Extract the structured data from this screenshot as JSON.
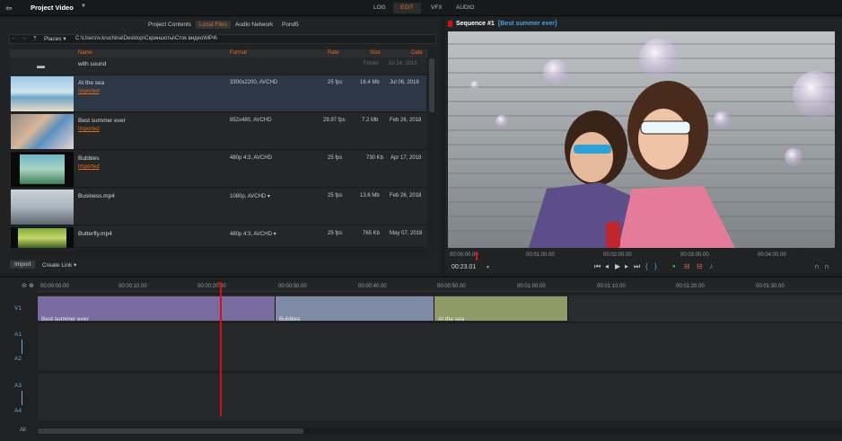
{
  "app": {
    "project_title": "Project Video",
    "modes": [
      "LOG",
      "EDIT",
      "VFX",
      "AUDIO"
    ],
    "active_mode": "EDIT"
  },
  "colors": {
    "accent": "#e46b1b",
    "playhead": "#d01414",
    "sequence_name": "#4ea0e0"
  },
  "browser": {
    "tabs": [
      "Project Contents",
      "Local Files",
      "Audio Network",
      "Pond5"
    ],
    "active_tab": "Local Files",
    "places_label": "Places",
    "path": "C:\\Users\\v.kruchina\\Desktop\\Скриншоты\\Сток видео\\MP4\\",
    "columns": [
      "Name",
      "Format",
      "Rate",
      "Size",
      "Date"
    ],
    "folder": {
      "name": "with sound",
      "size": "Folder",
      "date": "Jul 24, 2018"
    },
    "files": [
      {
        "name": "At the sea",
        "status": "Imported",
        "format": "3300x2200, AVCHD",
        "rate": "25 fps",
        "size": "16.4 Mb",
        "date": "Jul 06, 2018"
      },
      {
        "name": "Best summer ever",
        "status": "Imported",
        "format": "852x480, AVCHD",
        "rate": "29.97 fps",
        "size": "7.2 Mb",
        "date": "Feb 26, 2018"
      },
      {
        "name": "Bubbles",
        "status": "Imported",
        "format": "480p 4:3, AVCHD",
        "rate": "25 fps",
        "size": "730 Kb",
        "date": "Apr 17, 2018"
      },
      {
        "name": "Business.mp4",
        "status": "",
        "format": "1080p, AVCHD ▾",
        "rate": "25 fps",
        "size": "13.6 Mb",
        "date": "Feb 26, 2018"
      },
      {
        "name": "Butterfly.mp4",
        "status": "",
        "format": "480p 4:3, AVCHD ▾",
        "rate": "25 fps",
        "size": "765 Kb",
        "date": "May 07, 2018"
      }
    ],
    "import_label": "Import",
    "create_link_label": "Create Link"
  },
  "viewer": {
    "title": "Sequence #1",
    "sequence_name": "[Best summer ever]",
    "ruler": [
      "00:00:00.00",
      "00:01:00.00",
      "00:02:00.00",
      "00:03:00.00",
      "00:04:00.00"
    ],
    "timecode": "00:23.01"
  },
  "timeline": {
    "ruler": [
      "00:00:00.00",
      "00:00:10.00",
      "00:00:20.00",
      "00:00:30.00",
      "00:00:40.00",
      "00:00:50.00",
      "00:01:00.00",
      "00:01:10.00",
      "00:01:20.00",
      "00:01:30.00"
    ],
    "tracks": [
      "V1",
      "A1",
      "A2",
      "A3",
      "A4"
    ],
    "footer_label": "All",
    "clips": [
      {
        "name": "Best summer ever",
        "color": "#7a6aa0"
      },
      {
        "name": "Bubbles",
        "color": "#7f8aa8"
      },
      {
        "name": "At the sea",
        "color": "#8f9a66"
      }
    ]
  }
}
